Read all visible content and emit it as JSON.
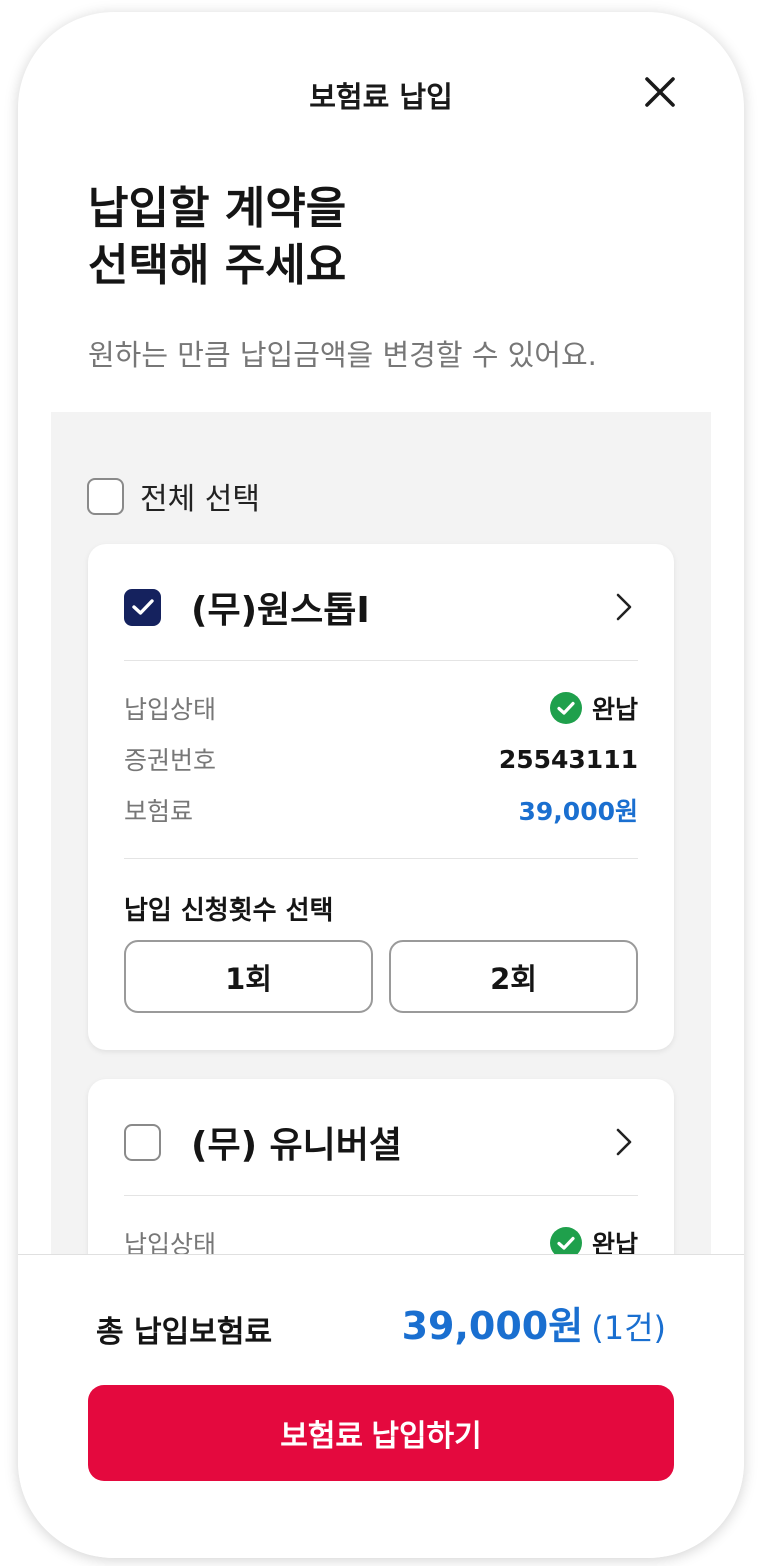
{
  "header": {
    "title": "보험료 납입",
    "close_icon": "close-icon"
  },
  "headline": {
    "line1": "납입할 계약을",
    "line2": "선택해 주세요"
  },
  "subtitle": "원하는 만큼 납입금액을 변경할 수 있어요.",
  "select_all": {
    "label": "전체 선택",
    "checked": false
  },
  "contracts": [
    {
      "title": "(무)원스톱I",
      "checked": true,
      "status_label": "납입상태",
      "status_value": "완납",
      "policy_label": "증권번호",
      "policy_value": "25543111",
      "premium_label": "보험료",
      "premium_value": "39,000원",
      "count_section_label": "납입 신청횟수 선택",
      "count_options": [
        "1회",
        "2회"
      ]
    },
    {
      "title": "(무) 유니버셜",
      "checked": false,
      "status_label": "납입상태",
      "status_value": "완납"
    }
  ],
  "footer": {
    "total_label": "총 납입보험료",
    "total_amount": "39,000원",
    "total_count": "(1건)",
    "pay_button": "보험료 납입하기"
  },
  "colors": {
    "accent_blue": "#1a6fd0",
    "checkbox_navy": "#15225e",
    "status_green": "#1fa04c",
    "pay_red": "#e4093e"
  }
}
